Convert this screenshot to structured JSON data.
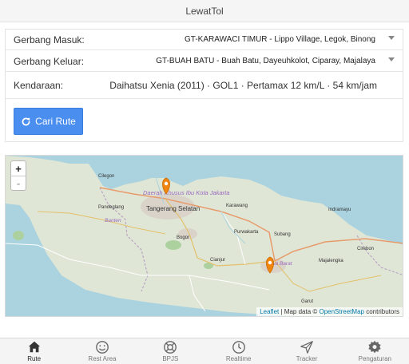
{
  "app": {
    "title": "LewatTol"
  },
  "form": {
    "entry_label": "Gerbang Masuk:",
    "entry_value": "GT-KARAWACI TIMUR - Lippo Village, Legok, Binong",
    "exit_label": "Gerbang Keluar:",
    "exit_value": "GT-BUAH BATU - Buah Batu, Dayeuhkolot, Ciparay, Majalaya",
    "vehicle_label": "Kendaraan:",
    "vehicle_value": "Daihatsu Xenia (2011) · GOL1 · Pertamax 12 km/L · 54 km/jam",
    "search_label": "Cari Rute"
  },
  "map": {
    "zoom_in": "+",
    "zoom_out": "-",
    "labels": {
      "cilegon": "Cilegon",
      "jakarta": "Daerah Khusus Ibu Kota Jakarta",
      "tangerang": "Tangerang Selatan",
      "karawang": "Karawang",
      "pandeglang": "Pandeglang",
      "banten": "Banten",
      "bogor": "Bogor",
      "purwakarta": "Purwakarta",
      "subang": "Subang",
      "indramayu": "Indramayu",
      "cianjur": "Cianjur",
      "jawa_barat": "Jawa Barat",
      "majalengka": "Majalengka",
      "cirebon": "Cirebon",
      "garut": "Garut"
    },
    "attribution_leaflet": "Leaflet",
    "attribution_text": " | Map data © ",
    "attribution_osm": "OpenStreetMap",
    "attribution_contrib": " contributors"
  },
  "tabs": [
    {
      "label": "Rute",
      "icon": "home-icon",
      "active": true
    },
    {
      "label": "Rest Area",
      "icon": "smiley-icon"
    },
    {
      "label": "BPJS",
      "icon": "lifebuoy-icon"
    },
    {
      "label": "Realtime",
      "icon": "clock-icon"
    },
    {
      "label": "Tracker",
      "icon": "send-icon"
    },
    {
      "label": "Pengaturan",
      "icon": "gear-icon"
    }
  ],
  "colors": {
    "accent": "#4a8ef0",
    "marker": "#f0860f",
    "sea": "#aad3df",
    "land": "#e0e8d4"
  }
}
